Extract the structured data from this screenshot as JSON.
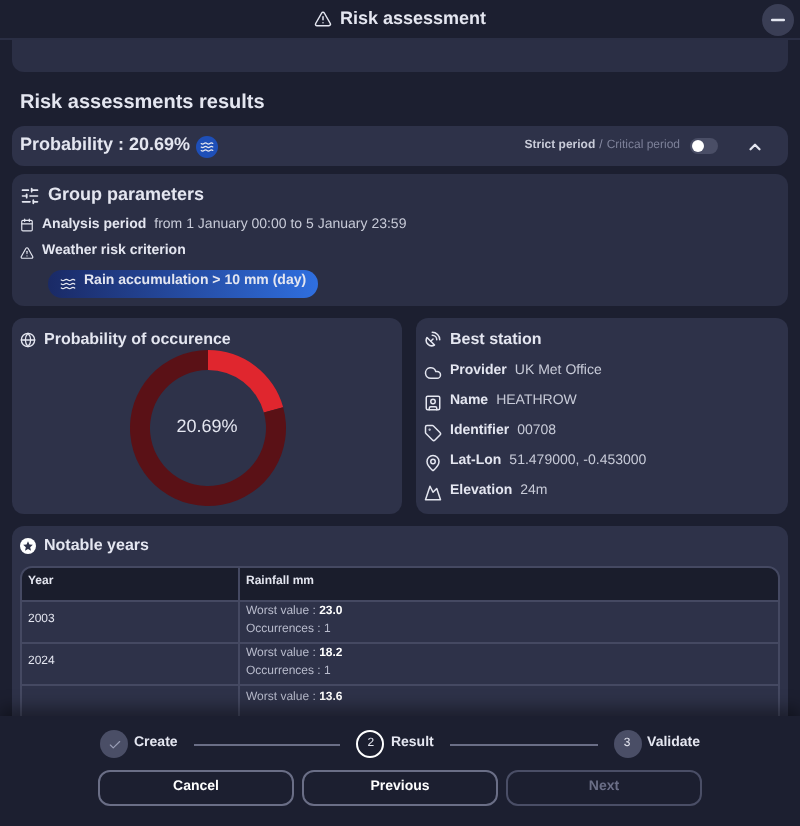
{
  "window": {
    "title": "Risk assessment"
  },
  "section_title": "Risk assessments results",
  "probability_bar": {
    "label": "Probability : 20.69%",
    "period_options": [
      {
        "label": "Strict period",
        "selected": true
      },
      {
        "label": "Critical period",
        "selected": false
      }
    ],
    "separator": "/",
    "toggle_on": false,
    "expanded": true
  },
  "group_parameters": {
    "title": "Group parameters",
    "analysis_period_label": "Analysis period",
    "analysis_period_value": "from 1 January 00:00 to 5 January 23:59",
    "criterion_label": "Weather risk criterion",
    "criterion_chip": "Rain accumulation > 10 mm (day)"
  },
  "probability_card": {
    "title": "Probability of occurence",
    "value": "20.69%",
    "chart_data": {
      "type": "donut",
      "values": [
        20.69,
        79.31
      ]
    }
  },
  "station_card": {
    "title": "Best station",
    "fields": [
      {
        "kind": "provider",
        "label": "Provider",
        "value": "UK Met Office"
      },
      {
        "kind": "name",
        "label": "Name",
        "value": "HEATHROW"
      },
      {
        "kind": "identifier",
        "label": "Identifier",
        "value": "00708"
      },
      {
        "kind": "location",
        "label": "Lat-Lon",
        "value": "51.479000, -0.453000"
      },
      {
        "kind": "elevation",
        "label": "Elevation",
        "value": "24m"
      }
    ]
  },
  "notable_years": {
    "title": "Notable years",
    "columns": [
      "Year",
      "Rainfall mm"
    ],
    "rows": [
      {
        "year": "2003",
        "worst_label": "Worst value : ",
        "worst_value": "23.0",
        "occurrences": "Occurrences : 1"
      },
      {
        "year": "2024",
        "worst_label": "Worst value : ",
        "worst_value": "18.2",
        "occurrences": "Occurrences : 1"
      },
      {
        "worst_label": "Worst value : ",
        "worst_value": "13.6"
      }
    ]
  },
  "steps": [
    {
      "label": "Create",
      "done": true,
      "current": false
    },
    {
      "number": "2",
      "label": "Result",
      "done": false,
      "current": true
    },
    {
      "number": "3",
      "label": "Validate",
      "done": false,
      "current": false
    }
  ],
  "buttons": [
    {
      "label": "Cancel",
      "disabled": false
    },
    {
      "label": "Previous",
      "disabled": false
    },
    {
      "label": "Next",
      "disabled": true
    }
  ]
}
